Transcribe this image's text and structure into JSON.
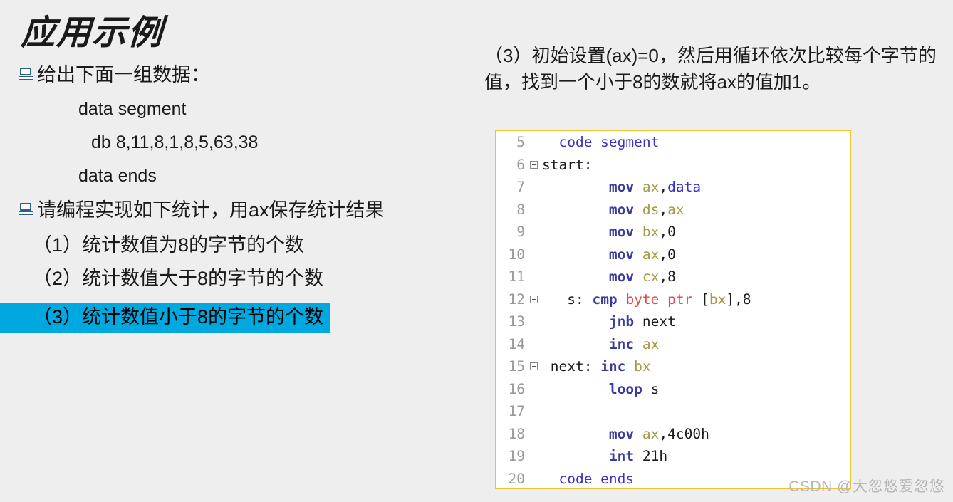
{
  "slide": {
    "title": "应用示例",
    "background_color": "#eeeeee"
  },
  "left": {
    "bullets": [
      {
        "icon": "laptop-icon",
        "text": "给出下面一组数据："
      },
      {
        "icon": "laptop-icon",
        "text": "请编程实现如下统计，用ax保存统计结果"
      }
    ],
    "data_listing": [
      "data segment",
      "db 8,11,8,1,8,5,63,38",
      "data ends"
    ],
    "tasks": [
      {
        "text": "（1）统计数值为8的字节的个数",
        "highlighted": false
      },
      {
        "text": "（2）统计数值大于8的字节的个数",
        "highlighted": false
      },
      {
        "text": "（3）统计数值小于8的字节的个数",
        "highlighted": true
      }
    ],
    "highlight_color": "#00a8e0"
  },
  "right": {
    "explanation": "（3）初始设置(ax)=0，然后用循环依次比较每个字节的值，找到一个小于8的数就将ax的值加1。",
    "code": {
      "border_color": "#f0c330",
      "background_color": "#ffffff",
      "lines": [
        {
          "num": "5",
          "fold": false,
          "tokens": [
            {
              "t": "  ",
              "c": "pl"
            },
            {
              "t": "code segment",
              "c": "kw"
            }
          ]
        },
        {
          "num": "6",
          "fold": true,
          "tokens": [
            {
              "t": "start:",
              "c": "pl"
            }
          ]
        },
        {
          "num": "7",
          "fold": false,
          "tokens": [
            {
              "t": "        ",
              "c": "pl"
            },
            {
              "t": "mov",
              "c": "op"
            },
            {
              "t": " ",
              "c": "pl"
            },
            {
              "t": "ax",
              "c": "reg"
            },
            {
              "t": ",",
              "c": "pl"
            },
            {
              "t": "data",
              "c": "kw"
            }
          ]
        },
        {
          "num": "8",
          "fold": false,
          "tokens": [
            {
              "t": "        ",
              "c": "pl"
            },
            {
              "t": "mov",
              "c": "op"
            },
            {
              "t": " ",
              "c": "pl"
            },
            {
              "t": "ds",
              "c": "reg"
            },
            {
              "t": ",",
              "c": "pl"
            },
            {
              "t": "ax",
              "c": "reg"
            }
          ]
        },
        {
          "num": "9",
          "fold": false,
          "tokens": [
            {
              "t": "        ",
              "c": "pl"
            },
            {
              "t": "mov",
              "c": "op"
            },
            {
              "t": " ",
              "c": "pl"
            },
            {
              "t": "bx",
              "c": "reg"
            },
            {
              "t": ",0",
              "c": "pl"
            }
          ]
        },
        {
          "num": "10",
          "fold": false,
          "tokens": [
            {
              "t": "        ",
              "c": "pl"
            },
            {
              "t": "mov",
              "c": "op"
            },
            {
              "t": " ",
              "c": "pl"
            },
            {
              "t": "ax",
              "c": "reg"
            },
            {
              "t": ",0",
              "c": "pl"
            }
          ]
        },
        {
          "num": "11",
          "fold": false,
          "tokens": [
            {
              "t": "        ",
              "c": "pl"
            },
            {
              "t": "mov",
              "c": "op"
            },
            {
              "t": " ",
              "c": "pl"
            },
            {
              "t": "cx",
              "c": "reg"
            },
            {
              "t": ",8",
              "c": "pl"
            }
          ]
        },
        {
          "num": "12",
          "fold": true,
          "tokens": [
            {
              "t": "   s: ",
              "c": "pl"
            },
            {
              "t": "cmp",
              "c": "op"
            },
            {
              "t": " ",
              "c": "pl"
            },
            {
              "t": "byte ptr",
              "c": "red"
            },
            {
              "t": " [",
              "c": "pl"
            },
            {
              "t": "bx",
              "c": "reg"
            },
            {
              "t": "],8",
              "c": "pl"
            }
          ]
        },
        {
          "num": "13",
          "fold": false,
          "tokens": [
            {
              "t": "        ",
              "c": "pl"
            },
            {
              "t": "jnb",
              "c": "op"
            },
            {
              "t": " next",
              "c": "pl"
            }
          ]
        },
        {
          "num": "14",
          "fold": false,
          "tokens": [
            {
              "t": "        ",
              "c": "pl"
            },
            {
              "t": "inc",
              "c": "op"
            },
            {
              "t": " ",
              "c": "pl"
            },
            {
              "t": "ax",
              "c": "reg"
            }
          ]
        },
        {
          "num": "15",
          "fold": true,
          "tokens": [
            {
              "t": " next: ",
              "c": "pl"
            },
            {
              "t": "inc",
              "c": "op"
            },
            {
              "t": " ",
              "c": "pl"
            },
            {
              "t": "bx",
              "c": "reg"
            }
          ]
        },
        {
          "num": "16",
          "fold": false,
          "tokens": [
            {
              "t": "        ",
              "c": "pl"
            },
            {
              "t": "loop",
              "c": "op"
            },
            {
              "t": " s",
              "c": "pl"
            }
          ]
        },
        {
          "num": "17",
          "fold": false,
          "tokens": []
        },
        {
          "num": "18",
          "fold": false,
          "tokens": [
            {
              "t": "        ",
              "c": "pl"
            },
            {
              "t": "mov",
              "c": "op"
            },
            {
              "t": " ",
              "c": "pl"
            },
            {
              "t": "ax",
              "c": "reg"
            },
            {
              "t": ",4c00h",
              "c": "pl"
            }
          ]
        },
        {
          "num": "19",
          "fold": false,
          "tokens": [
            {
              "t": "        ",
              "c": "pl"
            },
            {
              "t": "int",
              "c": "op"
            },
            {
              "t": " 21h",
              "c": "pl"
            }
          ]
        },
        {
          "num": "20",
          "fold": false,
          "tokens": [
            {
              "t": "  ",
              "c": "pl"
            },
            {
              "t": "code ends",
              "c": "kw"
            }
          ]
        }
      ]
    }
  },
  "watermark": "CSDN @大忽悠爱忽悠"
}
